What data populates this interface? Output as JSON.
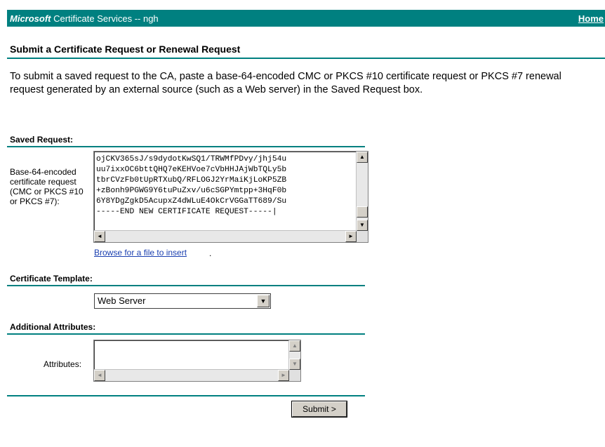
{
  "header": {
    "brand_bold": "Microsoft",
    "brand_rest": " Certificate Services  --  ngh",
    "home_link": "Home"
  },
  "page_title": "Submit a Certificate Request or Renewal Request",
  "intro_text": "To submit a saved request to the CA, paste a base-64-encoded CMC or PKCS #10 certificate request or PKCS #7 renewal request generated by an external source (such as a Web server) in the Saved Request box.",
  "saved_request": {
    "heading": "Saved Request:",
    "field_label": "Base-64-encoded certificate request (CMC or PKCS #10 or PKCS #7):",
    "value": "ojCKV365sJ/s9dydotKwSQ1/TRWMfPDvy/jhj54u\nuu7ixxOC6bttQHQ7eKEHVoe7cVbHHJAjWbTQLy5b\ntbrCVzFb0tUpRTXubQ/RFLOGJ2YrMaiKjLoKP5ZB\n+zBonh9PGWG9Y6tuPuZxv/u6cSGPYmtpp+3HqF0b\n6Y8YDgZgkD5AcupxZ4dWLuE4OkCrVGGaTT689/Su\n-----END NEW CERTIFICATE REQUEST-----|",
    "browse_link": "Browse for a file to insert",
    "browse_suffix": "."
  },
  "certificate_template": {
    "heading": "Certificate Template:",
    "selected": "Web Server"
  },
  "additional_attributes": {
    "heading": "Additional Attributes:",
    "field_label": "Attributes:",
    "value": ""
  },
  "submit_label": "Submit >",
  "icons": {
    "scroll_up": "▲",
    "scroll_down": "▼",
    "scroll_left": "◄",
    "scroll_right": "►",
    "dropdown": "▼"
  },
  "colors": {
    "accent": "#008080",
    "link": "#1a3fb0"
  }
}
